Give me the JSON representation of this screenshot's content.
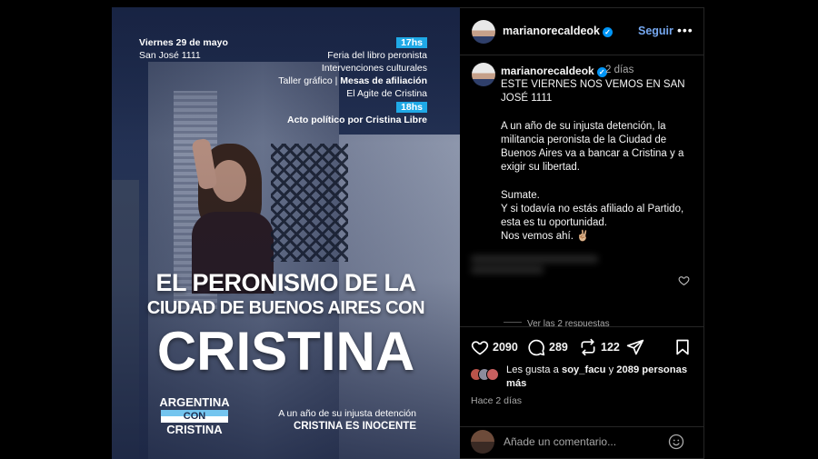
{
  "image": {
    "event_date": "Viernes 29 de mayo",
    "event_address": "San José 1111",
    "time_1": "17hs",
    "lines_1": [
      "Feria del libro peronista",
      "Intervenciones culturales",
      "El Agite de Cristina"
    ],
    "taller_label": "Taller gráfico |",
    "mesas_label": "Mesas de afiliación",
    "time_2": "18hs",
    "acto": "Acto político por Cristina Libre",
    "headline_1": "EL PERONISMO DE LA",
    "headline_2": "CIUDAD DE BUENOS AIRES CON",
    "headline_3": "CRISTINA",
    "logo_1": "ARGENTINA",
    "logo_2": "CON",
    "logo_3": "CRISTINA",
    "tagline_1": "A un año de su injusta detención",
    "tagline_2": "CRISTINA ES INOCENTE"
  },
  "header": {
    "username": "marianorecaldeok",
    "follow_label": "Seguir",
    "more_label": "•••"
  },
  "caption": {
    "username": "marianorecaldeok",
    "time": "2 días",
    "text": "ESTE VIERNES NOS VEMOS EN SAN JOSÉ 1111\n\nA un año de su injusta detención, la militancia peronista de la Ciudad de Buenos Aires va a bancar a Cristina y a exigir su libertad.\n\nSumate.\nY si todavía no estás afiliado al Partido, esta es tu oportunidad.\nNos vemos ahí. ✌🏼"
  },
  "comments": {
    "replies_label": "Ver las 2 respuestas"
  },
  "actions": {
    "likes": "2090",
    "comments": "289",
    "shares": "122"
  },
  "likes_summary": {
    "prefix": "Les gusta a",
    "user": "soy_facu",
    "joiner": "y",
    "others": "2089 personas más"
  },
  "post_age": "Hace 2 días",
  "composer": {
    "placeholder": "Añade un comentario..."
  },
  "colors": {
    "accent": "#0095f6",
    "follow": "#76a8f0",
    "time_badge": "#1fa9e6"
  }
}
